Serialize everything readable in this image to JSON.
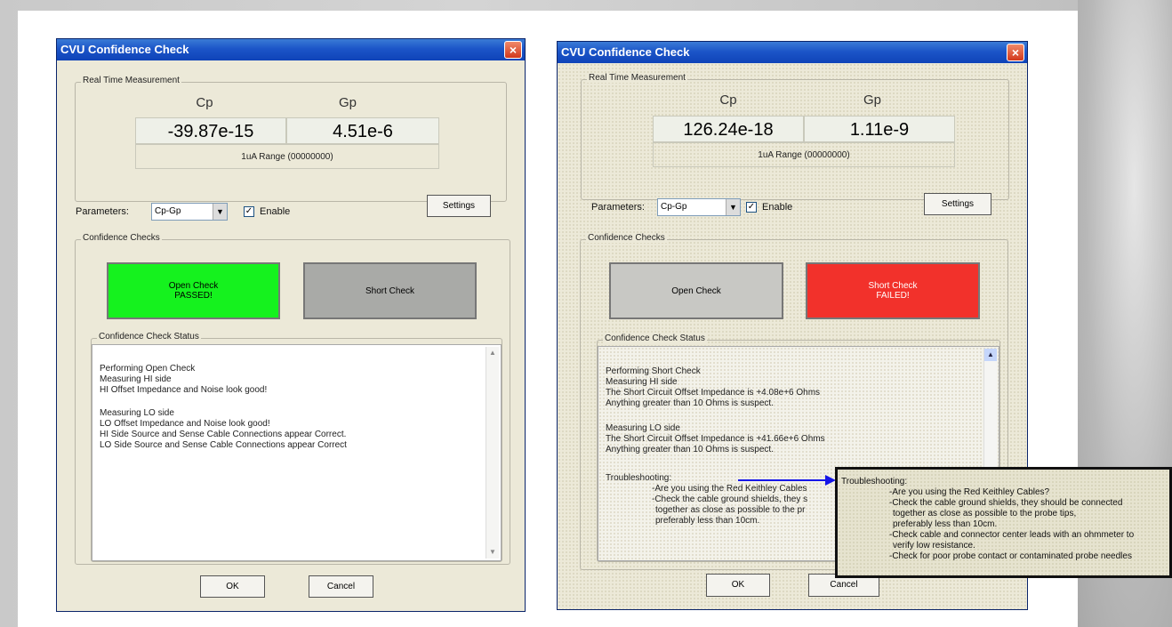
{
  "window1": {
    "title": "CVU Confidence Check",
    "close_label": "×",
    "rtm_group": "Real Time Measurement",
    "cp_header": "Cp",
    "gp_header": "Gp",
    "cp_value": "-39.87e-15",
    "gp_value": "4.51e-6",
    "range": "1uA Range (00000000)",
    "params_label": "Parameters:",
    "params_value": "Cp-Gp",
    "enable_label": "Enable",
    "enable_checked": "✓",
    "settings": "Settings",
    "conf_group": "Confidence Checks",
    "open_check": "Open Check",
    "open_status": "PASSED!",
    "short_check": "Short Check",
    "status_group": "Confidence Check Status",
    "status_lines": [
      "Performing Open Check",
      "Measuring HI side",
      "HI Offset Impedance and Noise look good!",
      "Measuring LO side",
      "LO Offset Impedance and Noise look good!",
      "HI Side Source and Sense Cable Connections appear Correct.",
      "LO Side Source and Sense Cable Connections appear Correct"
    ],
    "ok": "OK",
    "cancel": "Cancel",
    "colors": {
      "open_bg": "#15f21e",
      "short_bg": "#a9aaa7"
    }
  },
  "window2": {
    "title": "CVU Confidence Check",
    "close_label": "×",
    "rtm_group": "Real Time Measurement",
    "cp_header": "Cp",
    "gp_header": "Gp",
    "cp_value": "126.24e-18",
    "gp_value": "1.11e-9",
    "range": "1uA Range (00000000)",
    "params_label": "Parameters:",
    "params_value": "Cp-Gp",
    "enable_label": "Enable",
    "enable_checked": "✓",
    "settings": "Settings",
    "conf_group": "Confidence Checks",
    "open_check": "Open Check",
    "short_check": "Short Check",
    "short_status": "FAILED!",
    "status_group": "Confidence Check Status",
    "status_lines": [
      "Performing Short Check",
      "Measuring HI side",
      "The Short Circuit Offset Impedance is +4.08e+6 Ohms",
      "Anything greater than 10 Ohms is suspect.",
      "Measuring LO side",
      "The Short Circuit Offset Impedance is +41.66e+6 Ohms",
      "Anything greater than 10 Ohms is suspect.",
      "Troubleshooting:",
      "-Are you using the Red Keithley Cables",
      "-Check the cable ground shields, they s",
      "together as close as possible to the pr",
      "preferably less than 10cm."
    ],
    "ok": "OK",
    "cancel": "Cancel",
    "colors": {
      "open_bg": "#c8c8c4",
      "short_bg": "#f2312b"
    }
  },
  "callout": {
    "lines": [
      "Troubleshooting:",
      "-Are you using the Red Keithley Cables?",
      "-Check the cable ground shields, they should be connected",
      "together as close as possible to the probe tips,",
      "preferably less than 10cm.",
      "-Check cable and connector center leads with an ohmmeter to",
      "verify low resistance.",
      "-Check for poor probe contact or contaminated probe needles"
    ],
    "arrow_color": "#1616e8"
  }
}
